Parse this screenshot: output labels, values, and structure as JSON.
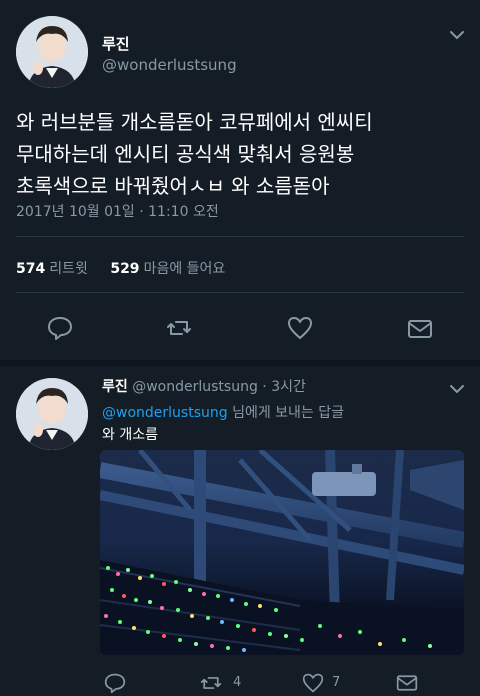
{
  "main_tweet": {
    "display_name": "루진",
    "handle": "@wonderlustsung",
    "text_lines": [
      "와 러브분들 개소름돋아 코뮤페에서 엔씨티",
      "무대하는데 엔시티 공식색 맞춰서 응원봉",
      "초록색으로 바꿔줬어ㅅㅂ 와 소름돋아"
    ],
    "timestamp": "2017년 10월 01일 · 11:10 오전",
    "retweets_count": "574",
    "retweets_label": "리트윗",
    "likes_count": "529",
    "likes_label": "마음에 들어요"
  },
  "reply_tweet": {
    "display_name": "루진",
    "handle": "@wonderlustsung",
    "time": "· 3시간",
    "replying_to_handle": "@wonderlustsung",
    "replying_to_suffix": "님에게 보내는 답글",
    "text": "와 개소름",
    "retweet_count": "4",
    "like_count": "7"
  },
  "icons": [
    "chevron-down-icon",
    "reply-icon",
    "retweet-icon",
    "heart-icon",
    "dm-icon"
  ],
  "colors": {
    "background": "#141d26",
    "muted": "#8899a6",
    "link": "#1da1f2",
    "divider": "#2a3744"
  }
}
